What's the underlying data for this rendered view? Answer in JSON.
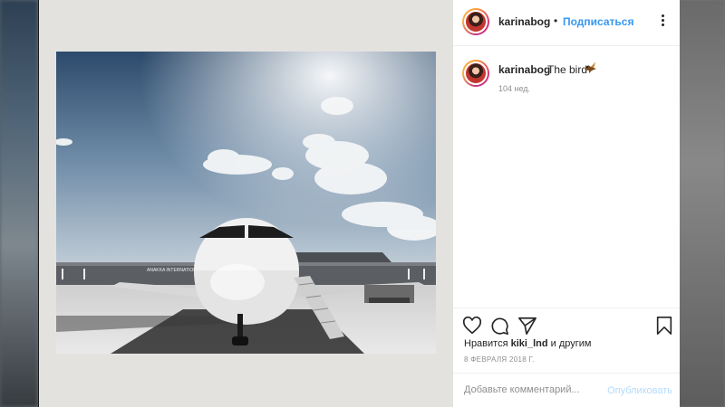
{
  "post": {
    "username": "karinabog",
    "separator": "•",
    "follow_label": "Подписаться",
    "caption_username": "karinabog",
    "caption_text": "The bird",
    "age": "104 нед.",
    "likes_prefix": "Нравится",
    "likes_user": "kiki_lnd",
    "likes_suffix": "и другим",
    "date": "8 ФЕВРАЛЯ 2018 Г."
  },
  "comment": {
    "placeholder": "Добавьте комментарий...",
    "post_label": "Опубликовать"
  },
  "photo": {
    "terminal_sign": "ANAKKA INTERNATIONAL"
  },
  "icons": {
    "caption_emoji": "bird-emoji",
    "like": "heart-icon",
    "comment": "comment-icon",
    "share": "share-icon",
    "save": "bookmark-icon",
    "options": "more-icon"
  },
  "colors": {
    "link_blue": "#3897f0",
    "post_disabled": "#b3dbff",
    "text": "#262626",
    "muted": "#8e8e8e"
  }
}
